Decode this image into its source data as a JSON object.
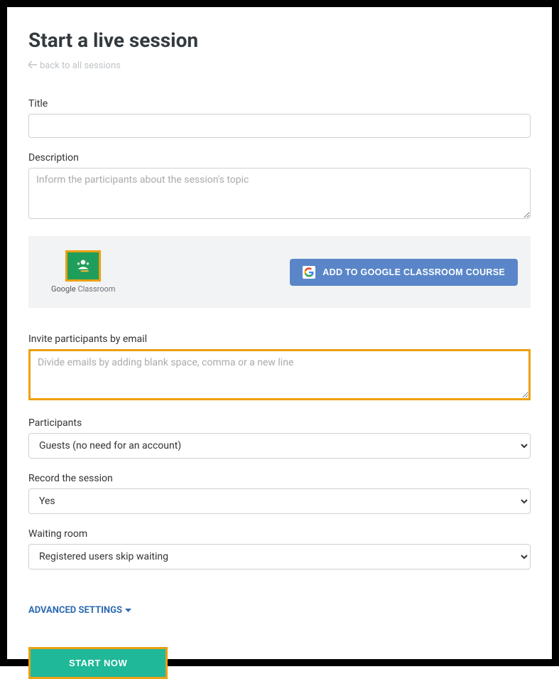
{
  "header": {
    "title": "Start a live session",
    "back_link": "back to all sessions"
  },
  "form": {
    "title_label": "Title",
    "title_value": "",
    "description_label": "Description",
    "description_placeholder": "Inform the participants about the session's topic",
    "description_value": "",
    "invite_label": "Invite participants by email",
    "invite_placeholder": "Divide emails by adding blank space, comma or a new line",
    "invite_value": "",
    "participants_label": "Participants",
    "participants_value": "Guests (no need for an account)",
    "record_label": "Record the session",
    "record_value": "Yes",
    "waiting_label": "Waiting room",
    "waiting_value": "Registered users skip waiting"
  },
  "google_classroom": {
    "caption_google": "Google",
    "caption_rest": " Classroom",
    "button_label": "ADD TO GOOGLE CLASSROOM COURSE"
  },
  "advanced_link": "ADVANCED SETTINGS",
  "start_button": "START NOW"
}
